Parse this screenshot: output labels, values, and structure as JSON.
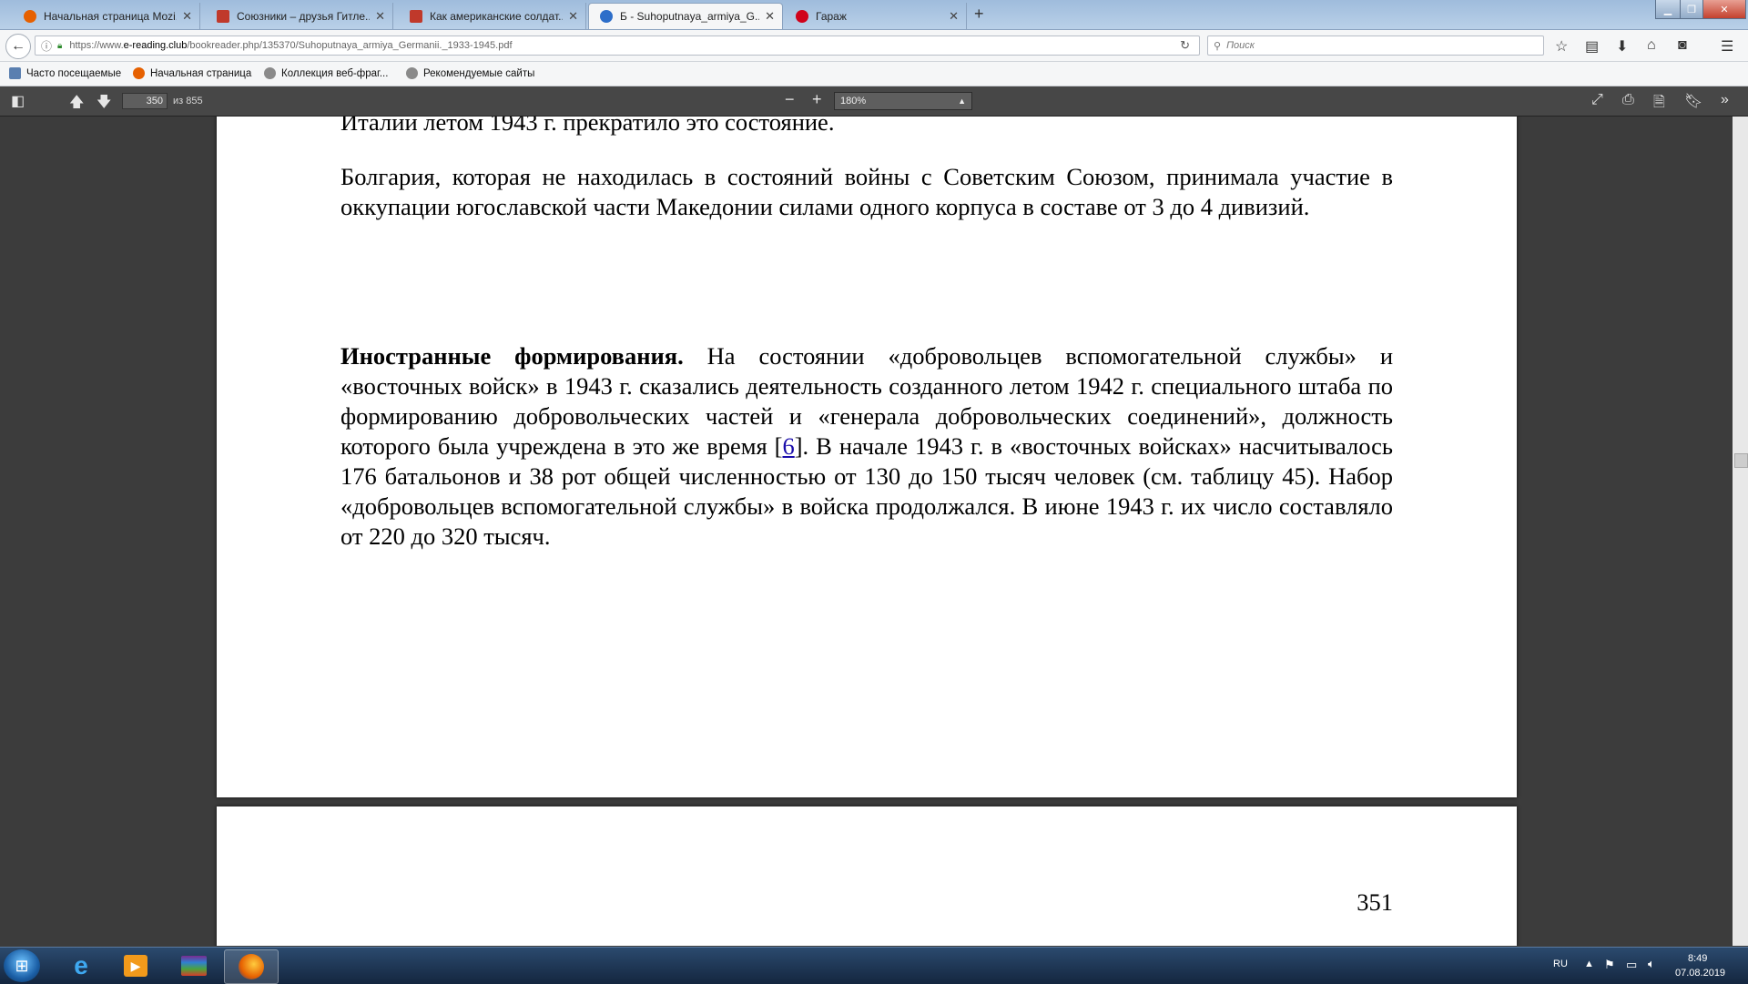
{
  "tabs": [
    {
      "label": "Начальная страница Mozi...",
      "icon_color": "#e66000",
      "active": false
    },
    {
      "label": "Союзники – друзья Гитле...",
      "icon_color": "#c0392b",
      "active": false
    },
    {
      "label": "Как американские солдат...",
      "icon_color": "#c0392b",
      "active": false
    },
    {
      "label": "Б - Suhoputnaya_armiya_G...",
      "icon_color": "#2d6ec9",
      "active": true
    },
    {
      "label": "Гараж",
      "icon_color": "#d0021b",
      "active": false
    }
  ],
  "newtab_symbol": "+",
  "navbar": {
    "url_prefix": "https://www.",
    "url_host": "e-reading.club",
    "url_path": "/bookreader.php/135370/Suhoputnaya_armiya_Germanii._1933-1945.pdf",
    "search_placeholder": "Поиск"
  },
  "bookmarks": [
    {
      "label": "Часто посещаемые"
    },
    {
      "label": "Начальная страница"
    },
    {
      "label": "Коллекция веб-фраг..."
    },
    {
      "label": "Рекомендуемые сайты"
    }
  ],
  "pdf_toolbar": {
    "page_current": "350",
    "page_total_label": "из 855",
    "zoom_value": "180%"
  },
  "page1": {
    "line_top": "Италии летом 1943 г. прекратило это состояние.",
    "para_bulgaria": "Болгария, которая не находилась в состояний войны с Советским Союзом, принимала участие в оккупации югославской части Македонии силами одного корпуса в составе от 3 до 4 дивизий.",
    "para_foreign_bold": "Иностранные формирования.",
    "para_foreign_text_a": " На состоянии «добровольцев вспомогательной службы» и «восточных войск» в 1943 г. сказались деятельность созданного летом 1942 г. специального штаба по формированию добровольческих частей и «генерала добровольческих соединений», должность которого была учреждена в это же время [",
    "para_foreign_link": "6",
    "para_foreign_text_b": "]. В начале 1943 г. в «восточных войсках» насчитывалось 176 батальонов и 38 рот общей численностью от 130 до 150 тысяч человек (см. таблицу 45). Набор «добровольцев вспомогательной службы» в войска продолжался. В июне 1943 г. их число составляло от 220 до 320 тысяч."
  },
  "page2": {
    "page_number": "351"
  },
  "tray": {
    "language": "RU",
    "time": "8:49",
    "date": "07.08.2019"
  }
}
